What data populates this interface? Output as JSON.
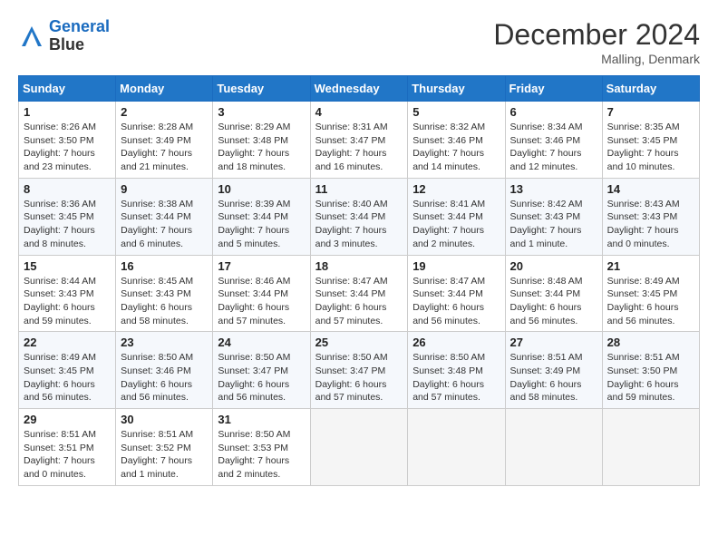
{
  "header": {
    "logo_line1": "General",
    "logo_line2": "Blue",
    "month_title": "December 2024",
    "location": "Malling, Denmark"
  },
  "weekdays": [
    "Sunday",
    "Monday",
    "Tuesday",
    "Wednesday",
    "Thursday",
    "Friday",
    "Saturday"
  ],
  "weeks": [
    [
      {
        "day": "1",
        "sunrise": "Sunrise: 8:26 AM",
        "sunset": "Sunset: 3:50 PM",
        "daylight": "Daylight: 7 hours and 23 minutes."
      },
      {
        "day": "2",
        "sunrise": "Sunrise: 8:28 AM",
        "sunset": "Sunset: 3:49 PM",
        "daylight": "Daylight: 7 hours and 21 minutes."
      },
      {
        "day": "3",
        "sunrise": "Sunrise: 8:29 AM",
        "sunset": "Sunset: 3:48 PM",
        "daylight": "Daylight: 7 hours and 18 minutes."
      },
      {
        "day": "4",
        "sunrise": "Sunrise: 8:31 AM",
        "sunset": "Sunset: 3:47 PM",
        "daylight": "Daylight: 7 hours and 16 minutes."
      },
      {
        "day": "5",
        "sunrise": "Sunrise: 8:32 AM",
        "sunset": "Sunset: 3:46 PM",
        "daylight": "Daylight: 7 hours and 14 minutes."
      },
      {
        "day": "6",
        "sunrise": "Sunrise: 8:34 AM",
        "sunset": "Sunset: 3:46 PM",
        "daylight": "Daylight: 7 hours and 12 minutes."
      },
      {
        "day": "7",
        "sunrise": "Sunrise: 8:35 AM",
        "sunset": "Sunset: 3:45 PM",
        "daylight": "Daylight: 7 hours and 10 minutes."
      }
    ],
    [
      {
        "day": "8",
        "sunrise": "Sunrise: 8:36 AM",
        "sunset": "Sunset: 3:45 PM",
        "daylight": "Daylight: 7 hours and 8 minutes."
      },
      {
        "day": "9",
        "sunrise": "Sunrise: 8:38 AM",
        "sunset": "Sunset: 3:44 PM",
        "daylight": "Daylight: 7 hours and 6 minutes."
      },
      {
        "day": "10",
        "sunrise": "Sunrise: 8:39 AM",
        "sunset": "Sunset: 3:44 PM",
        "daylight": "Daylight: 7 hours and 5 minutes."
      },
      {
        "day": "11",
        "sunrise": "Sunrise: 8:40 AM",
        "sunset": "Sunset: 3:44 PM",
        "daylight": "Daylight: 7 hours and 3 minutes."
      },
      {
        "day": "12",
        "sunrise": "Sunrise: 8:41 AM",
        "sunset": "Sunset: 3:44 PM",
        "daylight": "Daylight: 7 hours and 2 minutes."
      },
      {
        "day": "13",
        "sunrise": "Sunrise: 8:42 AM",
        "sunset": "Sunset: 3:43 PM",
        "daylight": "Daylight: 7 hours and 1 minute."
      },
      {
        "day": "14",
        "sunrise": "Sunrise: 8:43 AM",
        "sunset": "Sunset: 3:43 PM",
        "daylight": "Daylight: 7 hours and 0 minutes."
      }
    ],
    [
      {
        "day": "15",
        "sunrise": "Sunrise: 8:44 AM",
        "sunset": "Sunset: 3:43 PM",
        "daylight": "Daylight: 6 hours and 59 minutes."
      },
      {
        "day": "16",
        "sunrise": "Sunrise: 8:45 AM",
        "sunset": "Sunset: 3:43 PM",
        "daylight": "Daylight: 6 hours and 58 minutes."
      },
      {
        "day": "17",
        "sunrise": "Sunrise: 8:46 AM",
        "sunset": "Sunset: 3:44 PM",
        "daylight": "Daylight: 6 hours and 57 minutes."
      },
      {
        "day": "18",
        "sunrise": "Sunrise: 8:47 AM",
        "sunset": "Sunset: 3:44 PM",
        "daylight": "Daylight: 6 hours and 57 minutes."
      },
      {
        "day": "19",
        "sunrise": "Sunrise: 8:47 AM",
        "sunset": "Sunset: 3:44 PM",
        "daylight": "Daylight: 6 hours and 56 minutes."
      },
      {
        "day": "20",
        "sunrise": "Sunrise: 8:48 AM",
        "sunset": "Sunset: 3:44 PM",
        "daylight": "Daylight: 6 hours and 56 minutes."
      },
      {
        "day": "21",
        "sunrise": "Sunrise: 8:49 AM",
        "sunset": "Sunset: 3:45 PM",
        "daylight": "Daylight: 6 hours and 56 minutes."
      }
    ],
    [
      {
        "day": "22",
        "sunrise": "Sunrise: 8:49 AM",
        "sunset": "Sunset: 3:45 PM",
        "daylight": "Daylight: 6 hours and 56 minutes."
      },
      {
        "day": "23",
        "sunrise": "Sunrise: 8:50 AM",
        "sunset": "Sunset: 3:46 PM",
        "daylight": "Daylight: 6 hours and 56 minutes."
      },
      {
        "day": "24",
        "sunrise": "Sunrise: 8:50 AM",
        "sunset": "Sunset: 3:47 PM",
        "daylight": "Daylight: 6 hours and 56 minutes."
      },
      {
        "day": "25",
        "sunrise": "Sunrise: 8:50 AM",
        "sunset": "Sunset: 3:47 PM",
        "daylight": "Daylight: 6 hours and 57 minutes."
      },
      {
        "day": "26",
        "sunrise": "Sunrise: 8:50 AM",
        "sunset": "Sunset: 3:48 PM",
        "daylight": "Daylight: 6 hours and 57 minutes."
      },
      {
        "day": "27",
        "sunrise": "Sunrise: 8:51 AM",
        "sunset": "Sunset: 3:49 PM",
        "daylight": "Daylight: 6 hours and 58 minutes."
      },
      {
        "day": "28",
        "sunrise": "Sunrise: 8:51 AM",
        "sunset": "Sunset: 3:50 PM",
        "daylight": "Daylight: 6 hours and 59 minutes."
      }
    ],
    [
      {
        "day": "29",
        "sunrise": "Sunrise: 8:51 AM",
        "sunset": "Sunset: 3:51 PM",
        "daylight": "Daylight: 7 hours and 0 minutes."
      },
      {
        "day": "30",
        "sunrise": "Sunrise: 8:51 AM",
        "sunset": "Sunset: 3:52 PM",
        "daylight": "Daylight: 7 hours and 1 minute."
      },
      {
        "day": "31",
        "sunrise": "Sunrise: 8:50 AM",
        "sunset": "Sunset: 3:53 PM",
        "daylight": "Daylight: 7 hours and 2 minutes."
      },
      null,
      null,
      null,
      null
    ]
  ]
}
